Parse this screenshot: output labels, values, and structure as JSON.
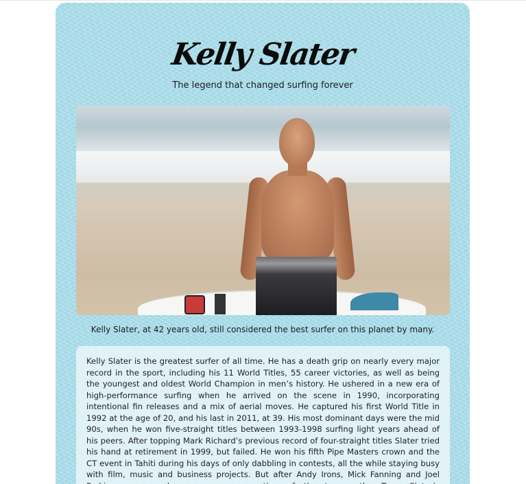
{
  "header": {
    "title": "Kelly Slater",
    "tagline": "The legend that changed surfing forever"
  },
  "photo": {
    "caption": "Kelly Slater, at 42 years old, still considered the best surfer on this planet by many."
  },
  "bio": {
    "text": "Kelly Slater is the greatest surfer of all time. He has a death grip on nearly every major record in the sport, including his 11 World Titles, 55 career victories, as well as being the youngest and oldest World Champion in men’s history. He ushered in a new era of high-performance surfing when he arrived on the scene in 1990, incorporating intentional fin releases and a mix of aerial moves. He captured his first World Title in 1992 at the age of 20, and his last in 2011, at 39. His most dominant days were the mid 90s, when he won five-straight titles between 1993-1998 surfing light years ahead of his peers. After topping Mark Richard’s previous record of four-straight titles Slater tried his hand at retirement in 1999, but failed. He won his fifth Pipe Masters crown and the CT event in Tahiti during his days of only dabbling in contests, all the while staying busy with film, music and business projects. But after Andy Irons, Mick Fanning and Joel Parkinson emerged as a new generation of threats on the Tour, Slater’s hypercompetitive drive was rekindled. He rejoined the Tour full"
  },
  "colors": {
    "card_background": "#a8dbe8",
    "bio_background": "#ebf7fa",
    "text": "#1f1f1f"
  }
}
